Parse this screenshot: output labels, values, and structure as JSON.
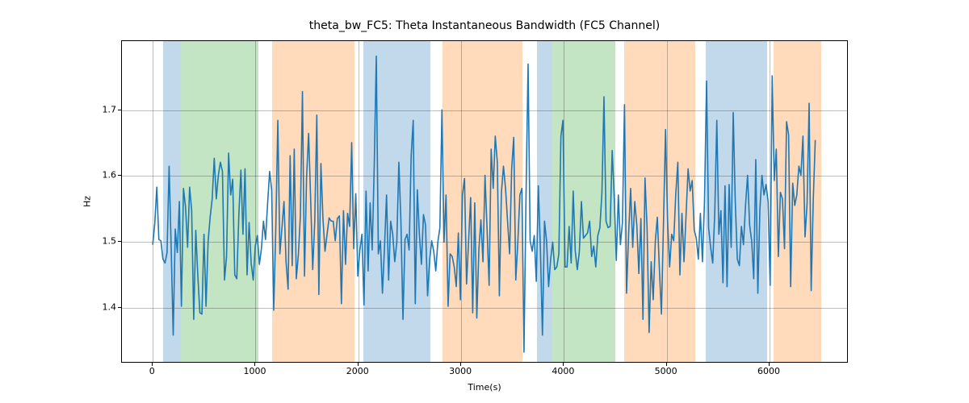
{
  "chart_data": {
    "type": "line",
    "title": "theta_bw_FC5: Theta Instantaneous Bandwidth (FC5 Channel)",
    "xlabel": "Time(s)",
    "ylabel": "Hz",
    "line_color": "#1f77b4",
    "xlim": [
      -300,
      6770
    ],
    "ylim": [
      1.315,
      1.805
    ],
    "xticks": [
      0,
      1000,
      2000,
      3000,
      4000,
      5000,
      6000
    ],
    "yticks": [
      1.4,
      1.5,
      1.6,
      1.7
    ],
    "shaded_regions": [
      {
        "start": 100,
        "end": 270,
        "color": "#1f77b4"
      },
      {
        "start": 270,
        "end": 1030,
        "color": "#2ca02c"
      },
      {
        "start": 1160,
        "end": 1960,
        "color": "#ff7f0e"
      },
      {
        "start": 2050,
        "end": 2700,
        "color": "#1f77b4"
      },
      {
        "start": 2820,
        "end": 3600,
        "color": "#ff7f0e"
      },
      {
        "start": 3740,
        "end": 3890,
        "color": "#1f77b4"
      },
      {
        "start": 3890,
        "end": 4500,
        "color": "#2ca02c"
      },
      {
        "start": 4590,
        "end": 5280,
        "color": "#ff7f0e"
      },
      {
        "start": 5380,
        "end": 5980,
        "color": "#1f77b4"
      },
      {
        "start": 6040,
        "end": 6500,
        "color": "#ff7f0e"
      }
    ],
    "x": [
      0,
      20,
      40,
      60,
      80,
      100,
      120,
      140,
      160,
      180,
      200,
      220,
      240,
      260,
      280,
      300,
      320,
      340,
      360,
      380,
      400,
      420,
      440,
      460,
      480,
      500,
      520,
      540,
      560,
      580,
      600,
      620,
      640,
      660,
      680,
      700,
      720,
      740,
      760,
      780,
      800,
      820,
      840,
      860,
      880,
      900,
      920,
      940,
      960,
      980,
      1000,
      1020,
      1040,
      1060,
      1080,
      1100,
      1120,
      1140,
      1160,
      1180,
      1200,
      1220,
      1240,
      1260,
      1280,
      1300,
      1320,
      1340,
      1360,
      1380,
      1400,
      1420,
      1440,
      1460,
      1480,
      1500,
      1520,
      1540,
      1560,
      1580,
      1600,
      1620,
      1640,
      1660,
      1680,
      1700,
      1720,
      1740,
      1760,
      1780,
      1800,
      1820,
      1840,
      1860,
      1880,
      1900,
      1920,
      1940,
      1960,
      1980,
      2000,
      2020,
      2040,
      2060,
      2080,
      2100,
      2120,
      2140,
      2160,
      2180,
      2200,
      2220,
      2240,
      2260,
      2280,
      2300,
      2320,
      2340,
      2360,
      2380,
      2400,
      2420,
      2440,
      2460,
      2480,
      2500,
      2520,
      2540,
      2560,
      2580,
      2600,
      2620,
      2640,
      2660,
      2680,
      2700,
      2720,
      2740,
      2760,
      2780,
      2800,
      2820,
      2840,
      2860,
      2880,
      2900,
      2920,
      2940,
      2960,
      2980,
      3000,
      3020,
      3040,
      3060,
      3080,
      3100,
      3120,
      3140,
      3160,
      3180,
      3200,
      3220,
      3240,
      3260,
      3280,
      3300,
      3320,
      3340,
      3360,
      3380,
      3400,
      3420,
      3440,
      3460,
      3480,
      3500,
      3520,
      3540,
      3560,
      3580,
      3600,
      3620,
      3640,
      3660,
      3680,
      3700,
      3720,
      3740,
      3760,
      3780,
      3800,
      3820,
      3840,
      3860,
      3880,
      3900,
      3920,
      3940,
      3960,
      3980,
      4000,
      4020,
      4040,
      4060,
      4080,
      4100,
      4120,
      4140,
      4160,
      4180,
      4200,
      4220,
      4240,
      4260,
      4280,
      4300,
      4320,
      4340,
      4360,
      4380,
      4400,
      4420,
      4440,
      4460,
      4480,
      4500,
      4520,
      4540,
      4560,
      4580,
      4600,
      4620,
      4640,
      4660,
      4680,
      4700,
      4720,
      4740,
      4760,
      4780,
      4800,
      4820,
      4840,
      4860,
      4880,
      4900,
      4920,
      4940,
      4960,
      4980,
      5000,
      5020,
      5040,
      5060,
      5080,
      5100,
      5120,
      5140,
      5160,
      5180,
      5200,
      5220,
      5240,
      5260,
      5280,
      5300,
      5320,
      5340,
      5360,
      5380,
      5400,
      5420,
      5440,
      5460,
      5480,
      5500,
      5520,
      5540,
      5560,
      5580,
      5600,
      5620,
      5640,
      5660,
      5680,
      5700,
      5720,
      5740,
      5760,
      5780,
      5800,
      5820,
      5840,
      5860,
      5880,
      5900,
      5920,
      5940,
      5960,
      5980,
      6000,
      6020,
      6040,
      6060,
      6080,
      6100,
      6120,
      6140,
      6160,
      6180,
      6200,
      6220,
      6240,
      6260,
      6280,
      6300,
      6320,
      6340,
      6360,
      6380,
      6400,
      6420,
      6440,
      6460
    ],
    "y": [
      1.494,
      1.526,
      1.582,
      1.502,
      1.5,
      1.472,
      1.466,
      1.482,
      1.614,
      1.49,
      1.356,
      1.518,
      1.482,
      1.56,
      1.4,
      1.58,
      1.552,
      1.49,
      1.582,
      1.546,
      1.38,
      1.516,
      1.446,
      1.39,
      1.388,
      1.51,
      1.4,
      1.498,
      1.536,
      1.564,
      1.626,
      1.564,
      1.6,
      1.62,
      1.606,
      1.44,
      1.476,
      1.634,
      1.57,
      1.594,
      1.448,
      1.442,
      1.54,
      1.608,
      1.51,
      1.61,
      1.448,
      1.528,
      1.466,
      1.44,
      1.492,
      1.508,
      1.464,
      1.488,
      1.53,
      1.502,
      1.556,
      1.606,
      1.578,
      1.394,
      1.518,
      1.684,
      1.48,
      1.52,
      1.56,
      1.468,
      1.426,
      1.63,
      1.462,
      1.64,
      1.442,
      1.478,
      1.538,
      1.728,
      1.446,
      1.596,
      1.664,
      1.564,
      1.456,
      1.53,
      1.692,
      1.418,
      1.618,
      1.534,
      1.484,
      1.51,
      1.535,
      1.53,
      1.53,
      1.5,
      1.534,
      1.538,
      1.404,
      1.546,
      1.464,
      1.542,
      1.522,
      1.65,
      1.488,
      1.572,
      1.446,
      1.486,
      1.51,
      1.402,
      1.576,
      1.454,
      1.558,
      1.486,
      1.614,
      1.782,
      1.48,
      1.5,
      1.42,
      1.49,
      1.57,
      1.44,
      1.53,
      1.51,
      1.468,
      1.498,
      1.62,
      1.53,
      1.38,
      1.502,
      1.51,
      1.486,
      1.63,
      1.684,
      1.404,
      1.578,
      1.51,
      1.464,
      1.54,
      1.524,
      1.416,
      1.47,
      1.5,
      1.484,
      1.454,
      1.498,
      1.52,
      1.7,
      1.498,
      1.57,
      1.4,
      1.48,
      1.476,
      1.46,
      1.43,
      1.512,
      1.41,
      1.57,
      1.595,
      1.434,
      1.5,
      1.566,
      1.39,
      1.558,
      1.382,
      1.486,
      1.532,
      1.468,
      1.6,
      1.518,
      1.432,
      1.64,
      1.58,
      1.66,
      1.62,
      1.416,
      1.574,
      1.614,
      1.58,
      1.53,
      1.48,
      1.61,
      1.658,
      1.44,
      1.498,
      1.57,
      1.58,
      1.33,
      1.57,
      1.77,
      1.5,
      1.484,
      1.508,
      1.438,
      1.584,
      1.488,
      1.356,
      1.53,
      1.5,
      1.43,
      1.472,
      1.498,
      1.456,
      1.46,
      1.48,
      1.66,
      1.684,
      1.46,
      1.46,
      1.522,
      1.466,
      1.576,
      1.484,
      1.456,
      1.484,
      1.56,
      1.504,
      1.508,
      1.512,
      1.53,
      1.476,
      1.492,
      1.46,
      1.508,
      1.52,
      1.574,
      1.72,
      1.53,
      1.52,
      1.522,
      1.638,
      1.566,
      1.47,
      1.57,
      1.494,
      1.528,
      1.708,
      1.42,
      1.51,
      1.58,
      1.49,
      1.56,
      1.524,
      1.45,
      1.534,
      1.38,
      1.596,
      1.52,
      1.36,
      1.468,
      1.41,
      1.498,
      1.536,
      1.458,
      1.388,
      1.526,
      1.67,
      1.53,
      1.46,
      1.51,
      1.5,
      1.572,
      1.62,
      1.448,
      1.542,
      1.468,
      1.538,
      1.61,
      1.576,
      1.592,
      1.516,
      1.504,
      1.472,
      1.542,
      1.468,
      1.56,
      1.744,
      1.52,
      1.49,
      1.466,
      1.542,
      1.684,
      1.51,
      1.546,
      1.436,
      1.584,
      1.43,
      1.586,
      1.49,
      1.696,
      1.56,
      1.472,
      1.462,
      1.522,
      1.494,
      1.554,
      1.6,
      1.524,
      1.5,
      1.442,
      1.624,
      1.42,
      1.548,
      1.6,
      1.57,
      1.586,
      1.56,
      1.432,
      1.752,
      1.592,
      1.64,
      1.476,
      1.574,
      1.564,
      1.488,
      1.682,
      1.662,
      1.43,
      1.588,
      1.554,
      1.57,
      1.614,
      1.6,
      1.66,
      1.506,
      1.556,
      1.71,
      1.424,
      1.56,
      1.654
    ]
  }
}
